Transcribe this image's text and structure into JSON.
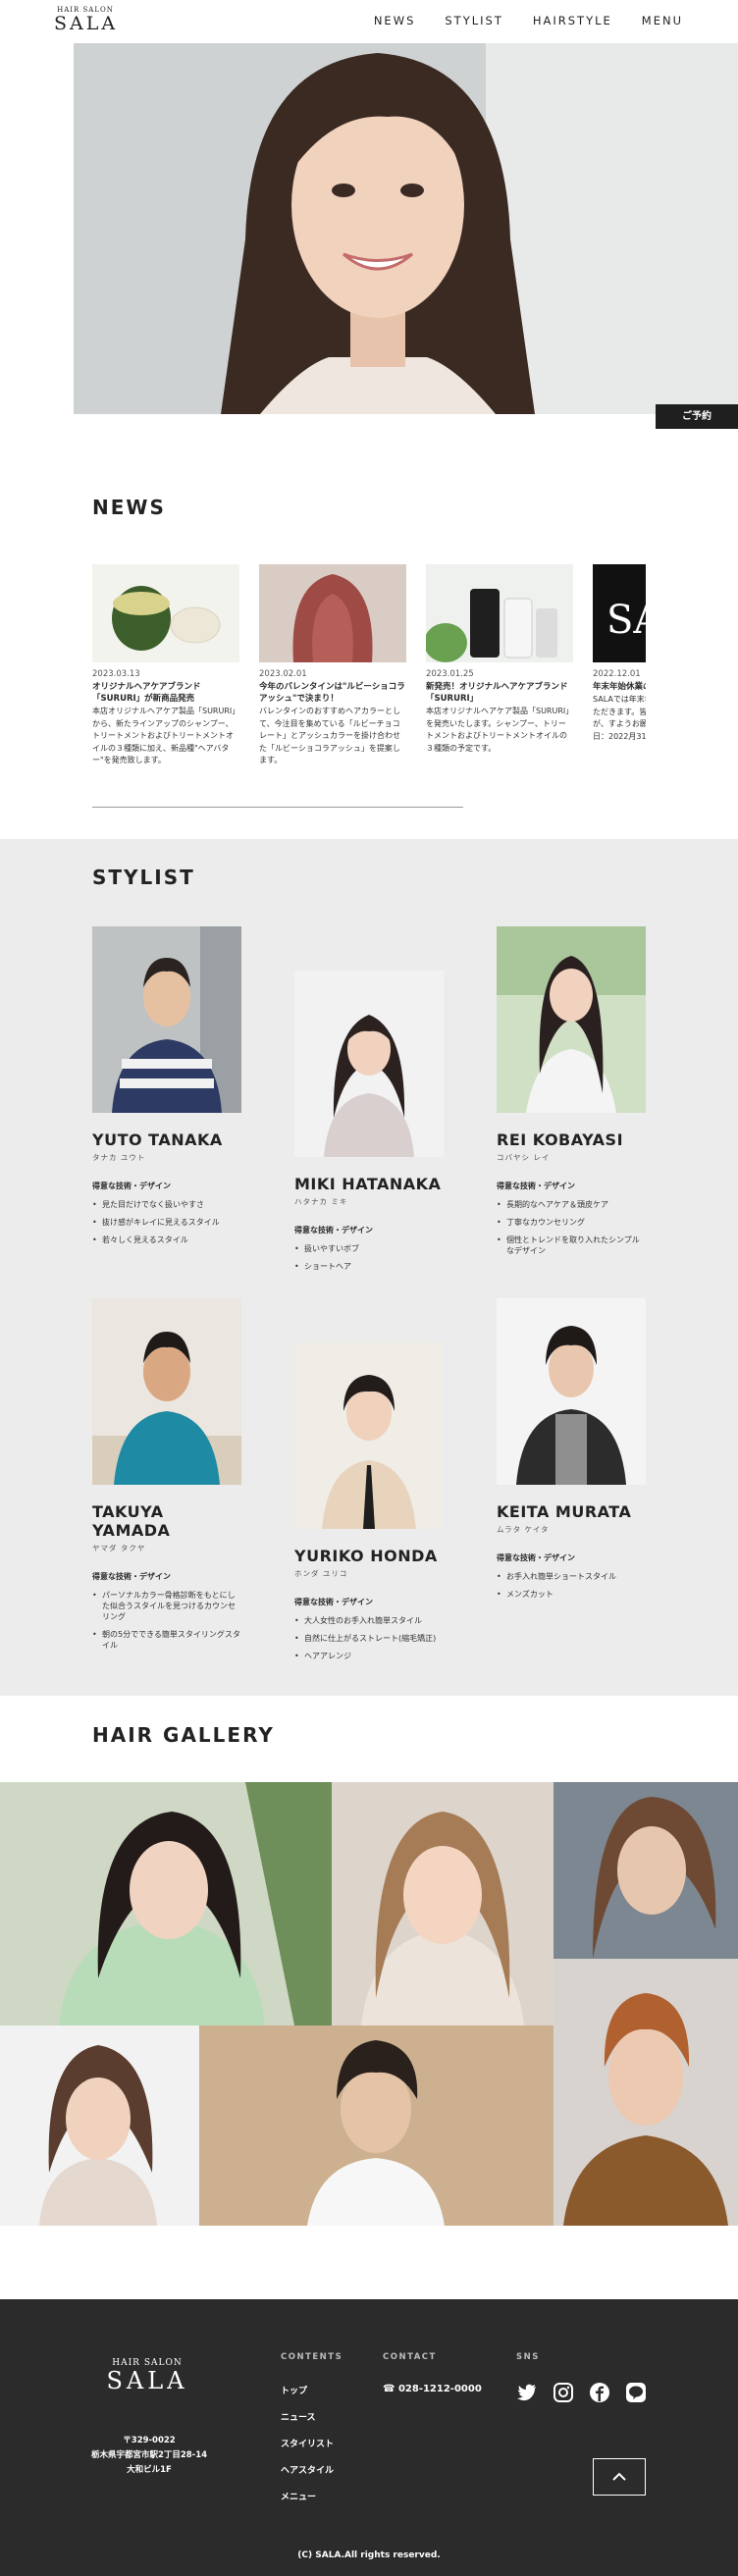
{
  "brand": {
    "small": "HAIR SALON",
    "name": "SALA"
  },
  "nav": [
    "NEWS",
    "STYLIST",
    "HAIRSTYLE",
    "MENU"
  ],
  "hero": {
    "button_label": "ご予約"
  },
  "news": {
    "title": "NEWS",
    "items": [
      {
        "date": "2023.03.13",
        "title": "オリジナルヘアケアブランド「SURURI」が新商品発売",
        "body": "本店オリジナルヘアケア製品「SURURI」から、新たラインアップのシャンプー、トリートメントおよびトリートメントオイルの３種類に加え、新品種\"ヘアバター\"を発売致します。"
      },
      {
        "date": "2023.02.01",
        "title": "今年のバレンタインは\"ルビーショコラアッシュ\"で決まり！",
        "body": "バレンタインのおすすめヘアカラーとして、今注目を集めている「ルビーチョコレート」とアッシュカラーを掛け合わせた「ルビーショコラアッシュ」を提案します。"
      },
      {
        "date": "2023.01.25",
        "title": "新発売！オリジナルヘアケアブランド「SURURI」",
        "body": "本店オリジナルヘアケア製品「SURURI」を発売いたします。シャンプー、トリートメントおよびトリートメントオイルの３種類の予定です。"
      },
      {
        "date": "2022.12.01",
        "title": "年末年始休業の",
        "body": "SALAでは年末年始、して、下記の日程にただきます。皆様におかけいたしますが、すようお願い申し上げます。休業日：2022月31日"
      }
    ]
  },
  "stylist": {
    "title": "STYLIST",
    "skill_heading": "得意な技術・デザイン",
    "items": [
      {
        "name": "YUTO TANAKA",
        "kana": "タナカ ユウト",
        "skills": [
          "見た目だけでなく扱いやすさ",
          "抜け感がキレイに見えるスタイル",
          "若々しく見えるスタイル"
        ]
      },
      {
        "name": "MIKI HATANAKA",
        "kana": "ハタナカ ミキ",
        "skills": [
          "扱いやすいボブ",
          "ショートヘア"
        ]
      },
      {
        "name": "REI KOBAYASI",
        "kana": "コバヤシ レイ",
        "skills": [
          "長期的なヘアケア＆頭皮ケア",
          "丁寧なカウンセリング",
          "個性とトレンドを取り入れたシンプルなデザイン"
        ]
      },
      {
        "name": "TAKUYA YAMADA",
        "kana": "ヤマダ タクヤ",
        "skills": [
          "パーソナルカラー骨格診断をもとにした似合うスタイルを見つけるカウンセリング",
          "朝の5分でできる簡単スタイリングスタイル"
        ]
      },
      {
        "name": "YURIKO HONDA",
        "kana": "ホンダ ユリコ",
        "skills": [
          "大人女性のお手入れ簡単スタイル",
          "自然に仕上がるストレート(縮毛矯正)",
          "ヘアアレンジ"
        ]
      },
      {
        "name": "KEITA MURATA",
        "kana": "ムラタ ケイタ",
        "skills": [
          "お手入れ簡単ショートスタイル",
          "メンズカット"
        ]
      }
    ]
  },
  "gallery": {
    "title": "HAIR GALLERY"
  },
  "footer": {
    "address": [
      "〒329-0022",
      "栃木県宇都宮市駅2丁目28-14",
      "大和ビル1F"
    ],
    "contents_heading": "CONTENTS",
    "contents": [
      "トップ",
      "ニュース",
      "スタイリスト",
      "ヘアスタイル",
      "メニュー"
    ],
    "contact_heading": "CONTACT",
    "phone": "028-1212-0000",
    "sns_heading": "SNS",
    "sns": [
      "twitter-icon",
      "instagram-icon",
      "facebook-icon",
      "line-icon"
    ],
    "copyright": "(C) SALA.All rights reserved."
  },
  "colors": {
    "dark": "#2b2b2b",
    "light_gray": "#ececec",
    "button": "#1f1f1f"
  }
}
